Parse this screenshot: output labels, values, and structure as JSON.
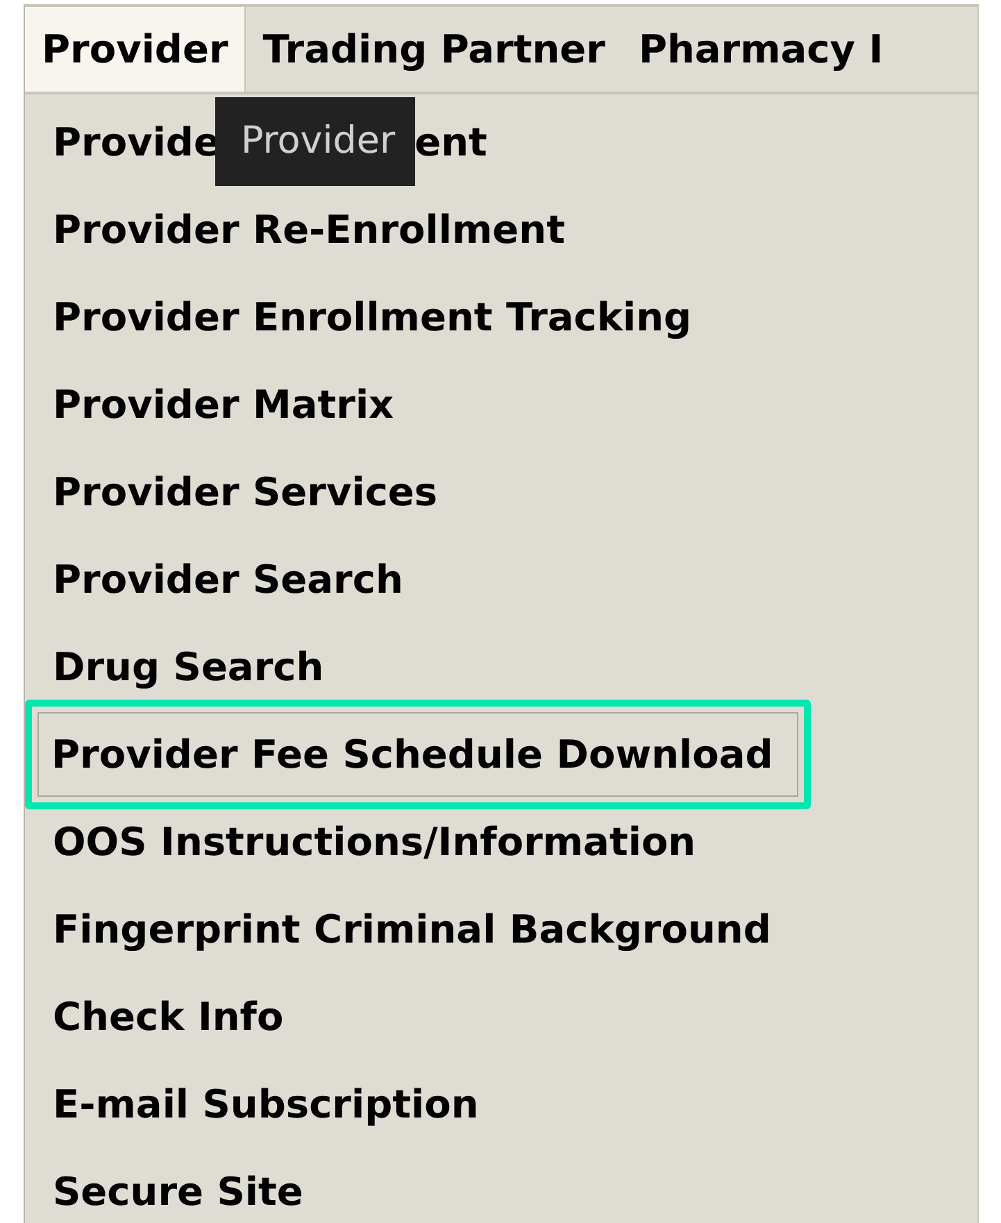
{
  "menubar": {
    "tabs": [
      {
        "label": "Provider",
        "selected": true
      },
      {
        "label": "Trading Partner",
        "selected": false
      },
      {
        "label": "Pharmacy I",
        "selected": false
      }
    ]
  },
  "tooltip": {
    "text": "Provider"
  },
  "menu": {
    "items": [
      {
        "kind": "covered",
        "text_before": "Provide",
        "text_after": "ent",
        "highlighted": false
      },
      {
        "kind": "plain",
        "label": "Provider Re-Enrollment",
        "highlighted": false
      },
      {
        "kind": "plain",
        "label": "Provider Enrollment Tracking",
        "highlighted": false
      },
      {
        "kind": "plain",
        "label": "Provider Matrix",
        "highlighted": false
      },
      {
        "kind": "plain",
        "label": "Provider Services",
        "highlighted": false
      },
      {
        "kind": "plain",
        "label": "Provider Search",
        "highlighted": false
      },
      {
        "kind": "plain",
        "label": "Drug Search",
        "highlighted": false
      },
      {
        "kind": "plain",
        "label": "Provider Fee Schedule Download",
        "highlighted": true
      },
      {
        "kind": "plain",
        "label": "OOS Instructions/Information",
        "highlighted": false
      },
      {
        "kind": "plain",
        "label": "Fingerprint Criminal Background",
        "highlighted": false
      },
      {
        "kind": "plain",
        "label": "Check Info",
        "highlighted": false
      },
      {
        "kind": "plain",
        "label": "E-mail Subscription",
        "highlighted": false
      },
      {
        "kind": "plain",
        "label": "Secure Site",
        "highlighted": false
      }
    ]
  }
}
